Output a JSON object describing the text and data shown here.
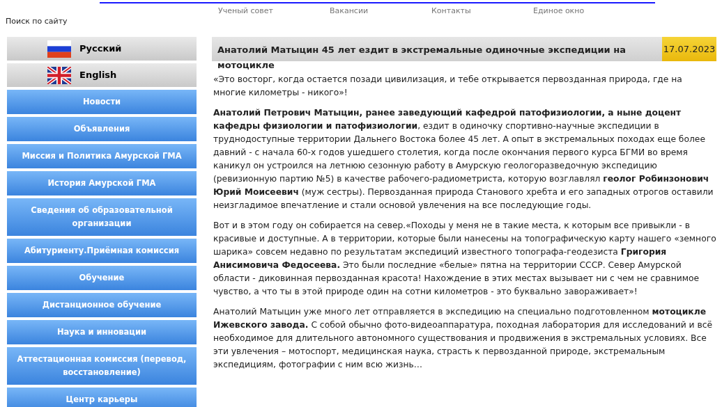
{
  "top_nav": [
    "Ученый совет",
    "Вакансии",
    "Контакты",
    "Единое окно"
  ],
  "search_label": "Поиск по сайту",
  "languages": [
    {
      "label": "Русский",
      "kind": "ru"
    },
    {
      "label": "English",
      "kind": "gb"
    }
  ],
  "sidebar": {
    "items": [
      "Новости",
      "Объявления",
      "Миссия и Политика Амурской ГМА",
      "История Амурской ГМА",
      "Сведения об образовательной организации",
      "Абитуриенту.Приёмная комиссия",
      "Обучение",
      "Дистанционное обучение",
      "Наука и инновации",
      "Аттестационная комиссия (перевод, восстановление)",
      "Центр карьеры"
    ]
  },
  "article": {
    "title": "Анатолий Матыцин 45 лет ездит в экстремальные одиночные экспедиции на мотоцикле",
    "date": "17.07.2023",
    "paragraphs": [
      "«Это восторг, когда остается позади цивилизация, и тебе открывается первозданная природа, где на многие километры - никого»!",
      "**Анатолий Петрович Матыцин, ранее заведующий кафедрой патофизиологии, а ныне доцент кафедры физиологии и патофизиологии**, ездит в одиночку спортивно-научные экспедиции в труднодоступные территории Дальнего Востока более 45 лет. А опыт в экстремальных походах еще более давний - с начала 60-х годов ушедшего столетия, когда после окончания первого курса БГМИ  во время каникул он устроился на летнюю сезонную работу в Амурскую геологоразведочную экспедицию (ревизионную партию №5) в качестве рабочего-радиометриста, которую возглавлял **геолог Робинзонович Юрий Моисеевич** (муж сестры). Первозданная природа Станового хребта и его западных отрогов оставили неизгладимое впечатление и стали основой увлечения на все последующие годы.",
      "Вот и в этом году он собирается на север.«Походы у меня не в такие места, к которым все привыкли - в красивые и доступные. А в территории, которые были нанесены на топографическую карту нашего «земного шарика» совсем недавно по результатам экспедиций известного топографа-геодезиста **Григория Анисимовича Федосеева.** Это были последние «белые» пятна на территории СССР. Север Амурской области - диковинная первозданная красота! Нахождение в этих местах вызывает ни с чем не сравнимое чувство, а что ты в этой природе один на сотни километров - это буквально завораживает»!",
      "Анатолий Матыцин уже много лет отправляется в экспедицию на специально подготовленном **мотоцикле Ижевского завода.** С собой обычно фото-видеоаппаратура, походная лаборатория для исследований и всё необходимое для длительного автономного существования и продвижения в экстремальных условиях. Все эти увлечения – мотоспорт, медицинская наука, страсть к первозданной природе, экстремальным экспедициям, фотографии с ним всю жизнь…"
    ]
  }
}
